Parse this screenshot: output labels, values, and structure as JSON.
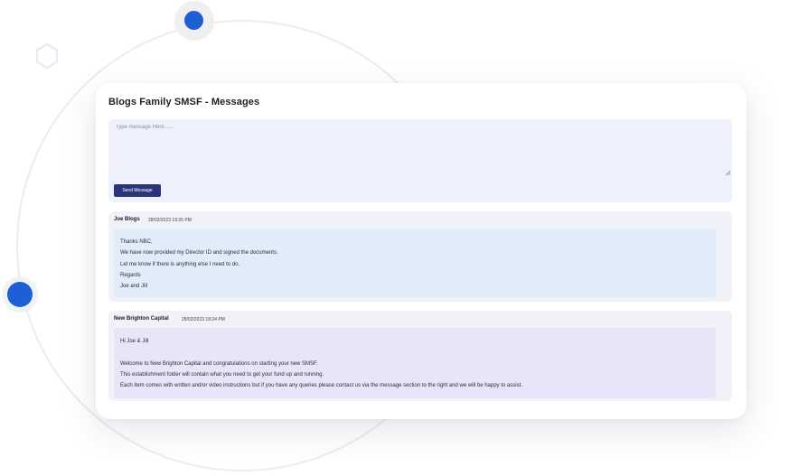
{
  "card": {
    "title": "Blogs Family SMSF - Messages"
  },
  "compose": {
    "placeholder": "Type message Here......",
    "send_label": "Send Message"
  },
  "messages": [
    {
      "author": "Joe Blogs",
      "timestamp": "28/02/2023 19:25 PM",
      "lines": [
        "Thanks NBC,",
        "We have now provided my Director ID and signed the documents.",
        "Let me know if there is anything else I need to do.",
        "Regards",
        "Joe and Jill"
      ]
    },
    {
      "author": "New Brighton Capital",
      "timestamp": "28/02/2023 18:24 PM",
      "lines": [
        "Hi Joe & Jill",
        "",
        "Welcome to New Brighton Capital and congratulations on starting your new SMSF.",
        "This establishment folder will contain what you need to get your fund up and running.",
        "Each item comes with written and/or video instructions but if you have any queries please contact us via the message section to the right and we will be happy to assist."
      ]
    }
  ],
  "colors": {
    "accent_blue": "#1f5fd6",
    "send_button": "#2a3577",
    "compose_bg": "#eef0fb",
    "message_bg": "#f1f2f8",
    "client_message_body": "#e0ecf8",
    "advisor_message_body": "#e6e6f8"
  },
  "icons": {
    "hexagon": "hexagon-outline-icon",
    "resize": "resize-handle-icon"
  }
}
